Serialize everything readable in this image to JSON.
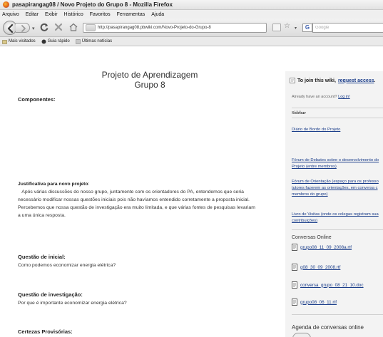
{
  "window": {
    "title": "pasapirangag08 / Novo Projeto do Grupo 8 - Mozilla Firefox"
  },
  "menubar": {
    "items": [
      "Arquivo",
      "Editar",
      "Exibir",
      "Histórico",
      "Favoritos",
      "Ferramentas",
      "Ajuda"
    ]
  },
  "navbar": {
    "url": "http://pasapirangag08.pbwiki.com/Novo-Projeto-do-Grupo-8",
    "search_placeholder": "Google",
    "search_engine_label": "G"
  },
  "bookmarks": {
    "items": [
      "Mais visitados",
      "Guia rápido",
      "Últimas notícias"
    ]
  },
  "main": {
    "title": "Projeto de Aprendizagem",
    "subtitle": "Grupo 8",
    "componentes_label": "Componentes:",
    "justificativa_label": "Justificativa para novo projeto",
    "justificativa_lines": [
      "   Após várias discussões do nosso grupo, juntamente com os orientadores do PA, entendemos que seria",
      "necessário modificar nossas questões iniciais pois não havíamos entendido corretamente a proposta inicial.",
      "Percebemos que nossa questão de investigação era muito limitada, e que  várias fontes de pesquisas levariam",
      "a uma única resposta."
    ],
    "questao_inicial_label": "Questão de inicial:",
    "questao_inicial_text": "Como podemos economizar energia elétrica?",
    "questao_investigacao_label": "Questão de investigação:",
    "questao_investigacao_text": "Por que é importante economizar energia elétrica?",
    "certezas_label": "Certezas Provisórias:"
  },
  "sidebar": {
    "join_prefix": "To join this wiki,",
    "join_link": "request access",
    "join_suffix": ".",
    "already_prefix": "Already have an account?",
    "login_link": "Log in!",
    "heading": "Sidebar",
    "links": [
      "Diário de Bordo do Projeto",
      "Fórum de Debates sobre o desenvolvimento do",
      "Projeto (entre membros)",
      "Fórum de Orientação (espaço para os professo",
      "tutores fazerem as orientações, em conversa c",
      "membros do grupo)",
      "Livro de Visitas (onde os colegas registram sua",
      "contribuições)"
    ],
    "conversas_heading": "Conversas Online",
    "files": [
      "grupo08_11_09_2008a.rtf",
      "g08_30_09_2008.rtf",
      "conversa_grupo_08_21_10.doc",
      "grupo08_06_11.rtf"
    ],
    "agenda_heading": "Agenda de conversas online"
  }
}
